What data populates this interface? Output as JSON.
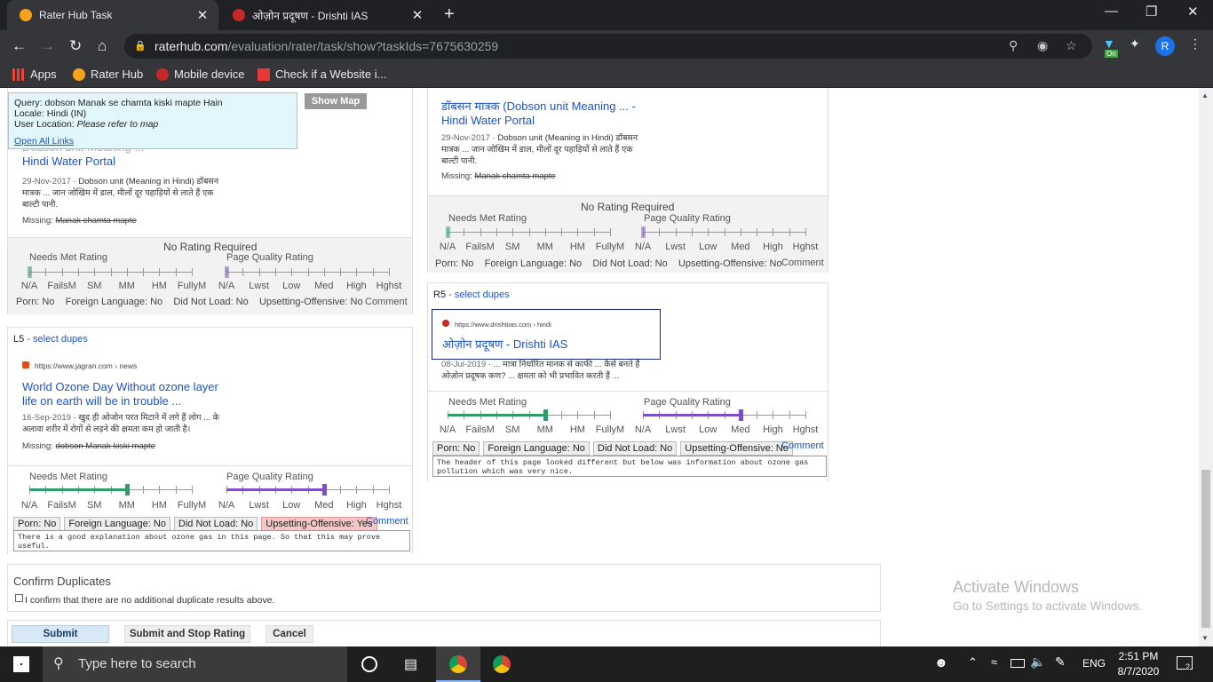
{
  "tabs": [
    {
      "title": "Rater Hub Task",
      "close": "✕"
    },
    {
      "title": "ओज़ोन प्रदूषण - Drishti IAS",
      "close": "✕"
    }
  ],
  "browser": {
    "new_tab": "+",
    "url_host": "raterhub.com",
    "url_path": "/evaluation/rater/task/show?taskIds=7675630259",
    "extension_badge": "On",
    "profile_initial": "R",
    "bookmarks": [
      "Apps",
      "Rater Hub",
      "Mobile device",
      "Check if a Website i..."
    ]
  },
  "query_box": {
    "query_label": "Query:",
    "query": "dobson Manak se chamta kiski mapte Hain",
    "locale_label": "Locale:",
    "locale": "Hindi (IN)",
    "user_location_label": "User Location:",
    "user_location": "Please refer to map",
    "open_links": "Open All Links",
    "show_map": "Show Map"
  },
  "scales": {
    "needs_met_label": "Needs Met Rating",
    "page_quality_label": "Page Quality Rating",
    "needs_met": [
      "N/A",
      "FailsM",
      "SM",
      "MM",
      "HM",
      "FullyM"
    ],
    "page_quality": [
      "N/A",
      "Lwst",
      "Low",
      "Med",
      "High",
      "Hghst"
    ]
  },
  "labels": {
    "no_rating": "No Rating Required",
    "comment": "Comment",
    "select_dupes": "- select dupes",
    "missing": "Missing:"
  },
  "flags_no": {
    "porn": "Porn: No",
    "foreign": "Foreign Language: No",
    "not_load": "Did Not Load: No",
    "upsetting": "Upsetting-Offensive: No"
  },
  "left_top": {
    "title_partial": "Dobson unit Meaning ...",
    "title_line2": "Hindi Water Portal",
    "snippet_date": "29-Nov-2017",
    "snippet": " · Dobson unit (Meaning in Hindi) डॉबसन मात्रक ... जान जोखिम में डाल, मीलों दूर पहाड़ियों से लाते हैं एक बाल्टी पानी.",
    "missing": "Manak chamta mapte"
  },
  "right_top": {
    "title": "डॉबसन मात्रक (Dobson unit Meaning ... -",
    "title_line2": "Hindi Water Portal",
    "snippet_date": "29-Nov-2017",
    "snippet": " · Dobson unit (Meaning in Hindi) डॉबसन मात्रक ... जान जोखिम में डाल, मीलों दूर पहाड़ियों से लाते हैं एक बाल्टी पानी.",
    "missing": "Manak chamta mapte"
  },
  "l5": {
    "id": "L5",
    "url": "https://www.jagran.com › news",
    "title": "World Ozone Day Without ozone layer life on earth will be in trouble ...",
    "snippet_date": "16-Sep-2019",
    "snippet": " · खुद ही ओजोन परत मिटाने में लगे हैं लोग ... के अलावा शरीर में रोगों से लड़ने की क्षमता कम हो जाती है।",
    "missing": "dobson Manak kiski mapte",
    "needs_met_value": "MM",
    "page_quality_value": "Med",
    "flags": {
      "porn": "Porn: No",
      "foreign": "Foreign Language: No",
      "not_load": "Did Not Load: No",
      "upsetting": "Upsetting-Offensive: Yes"
    },
    "comment": "There is a good explanation about ozone gas in this page. So that this may prove useful."
  },
  "r5": {
    "id": "R5",
    "url": "https://www.drishtiias.com › hindi",
    "title": "ओज़ोन प्रदूषण - Drishti IAS",
    "snippet_date": "08-Jul-2019",
    "snippet": " · ... मात्रा निर्धारित मानक से काफी ... कैसे बनते हैं ओज़ोन प्रदूषक कण? ... क्षमता को भी प्रभावित करती हैं ...",
    "needs_met_value": "MM",
    "page_quality_value": "Med",
    "comment": "The header of this page looked different but below was information about ozone gas pollution which was very nice."
  },
  "confirm": {
    "title": "Confirm Duplicates",
    "checkbox": "I confirm that there are no additional duplicate results above."
  },
  "actions": {
    "submit": "Submit",
    "submit_stop": "Submit and Stop Rating",
    "cancel": "Cancel"
  },
  "watermark": {
    "line1": "Activate Windows",
    "line2": "Go to Settings to activate Windows."
  },
  "taskbar": {
    "search": "Type here to search",
    "lang": "ENG",
    "time": "2:51 PM",
    "date": "8/7/2020",
    "notif": "2"
  },
  "colors": {
    "needs_met": "#2e9d6a",
    "page_quality": "#7a4fc8",
    "link": "#1a55c8",
    "alert": "#f4c6c6"
  }
}
